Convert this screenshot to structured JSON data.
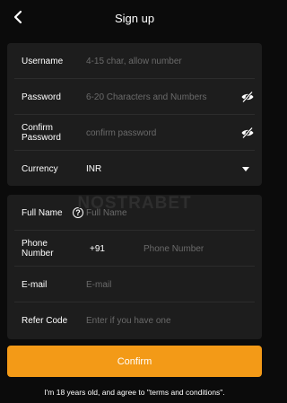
{
  "header": {
    "title": "Sign up",
    "back_icon": "chevron-left-icon"
  },
  "form": {
    "username": {
      "label": "Username",
      "placeholder": "4-15 char, allow number"
    },
    "password": {
      "label": "Password",
      "placeholder": "6-20 Characters and Numbers",
      "toggle_icon": "eye-off-icon"
    },
    "confirm_password": {
      "label_line1": "Confirm",
      "label_line2": "Password",
      "placeholder": "confirm password",
      "toggle_icon": "eye-off-icon"
    },
    "currency": {
      "label": "Currency",
      "value": "INR",
      "dropdown_icon": "caret-down-icon"
    },
    "full_name": {
      "label": "Full Name",
      "placeholder": "Full Name",
      "help_icon": "question-circle-icon",
      "help_glyph": "?"
    },
    "phone": {
      "label_line1": "Phone",
      "label_line2": "Number",
      "country_code": "+91",
      "placeholder": "Phone Number"
    },
    "email": {
      "label": "E-mail",
      "placeholder": "E-mail"
    },
    "refer_code": {
      "label": "Refer Code",
      "placeholder": "Enter if you have one"
    }
  },
  "watermark": "NOSTRABET",
  "confirm_label": "Confirm",
  "agree_text": "I'm 18 years old, and agree to \"terms and conditions\".",
  "colors": {
    "accent": "#f39a17",
    "background": "#0b0b0b",
    "card": "#1d1d1d",
    "placeholder": "#6a6a6a"
  }
}
